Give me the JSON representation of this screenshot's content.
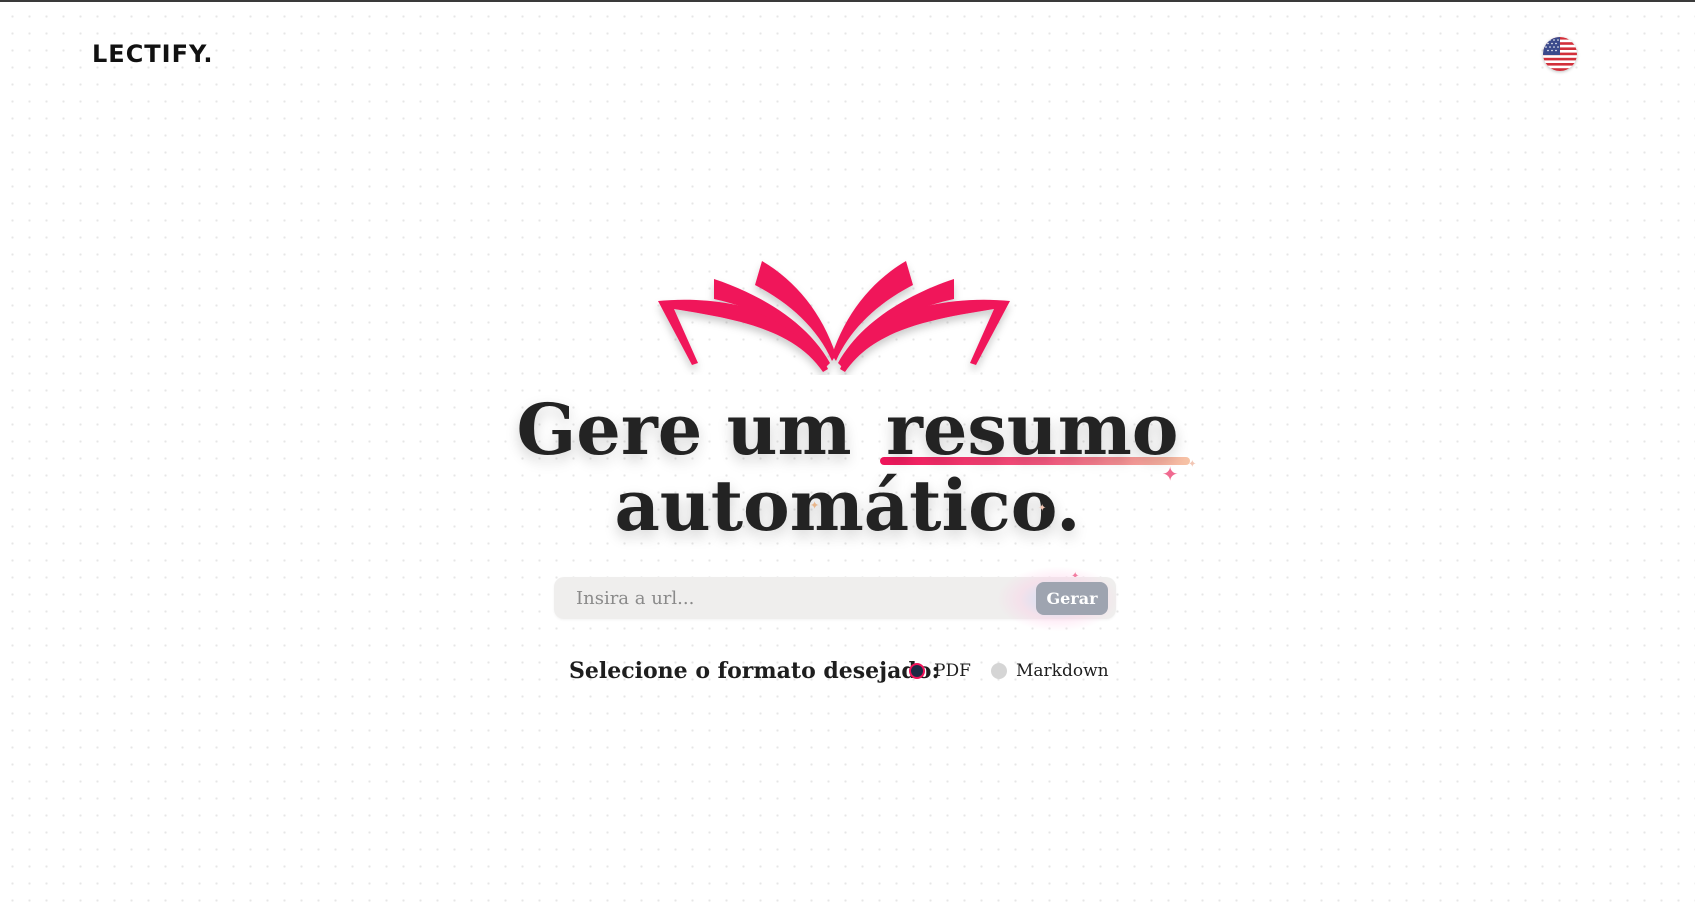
{
  "brand": {
    "logo_text": "LECTIFY."
  },
  "language": {
    "icon": "us-flag-icon"
  },
  "hero": {
    "icon": "open-book-icon",
    "line1_prefix": "Gere um",
    "line1_highlight": "resumo",
    "line2": "automático."
  },
  "search": {
    "placeholder": "Insira a url...",
    "value": "",
    "button_label": "Gerar"
  },
  "format": {
    "label": "Selecione o formato desejado:",
    "options": [
      {
        "label": "PDF",
        "selected": true
      },
      {
        "label": "Markdown",
        "selected": false
      }
    ]
  },
  "colors": {
    "accent": "#f0145a",
    "button_bg": "#9ea4b0",
    "input_bg": "#efeeed",
    "text": "#232323"
  }
}
